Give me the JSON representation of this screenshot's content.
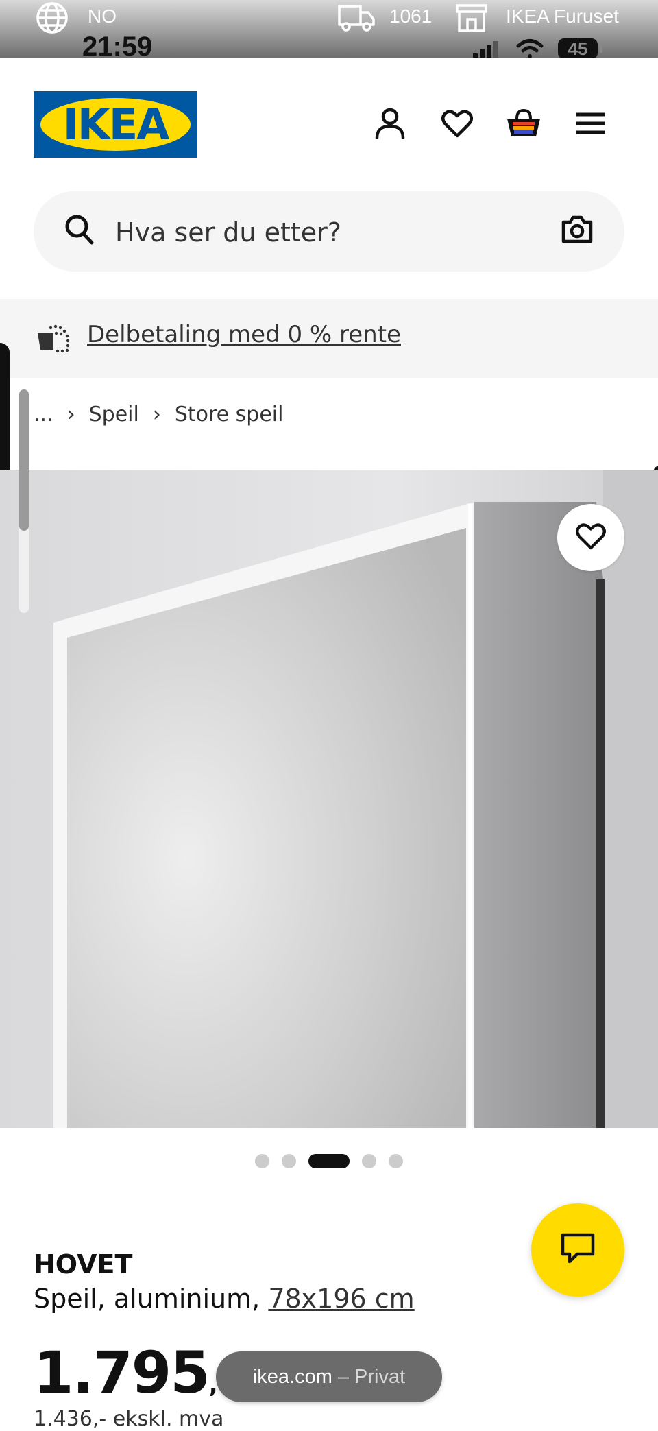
{
  "status_bar": {
    "language": "NO",
    "delivery_postcode": "1061",
    "store": "IKEA Furuset",
    "time": "21:59",
    "battery": "45"
  },
  "header": {
    "logo_text": "IKEA",
    "logo_reg": "®",
    "icons": [
      "profile-icon",
      "heart-icon",
      "basket-icon",
      "menu-icon"
    ]
  },
  "search": {
    "placeholder": "Hva ser du etter?"
  },
  "promo": {
    "text": "Delbetaling med 0 % rente"
  },
  "breadcrumb": {
    "ellipsis": "...",
    "items": [
      "Speil",
      "Store speil"
    ]
  },
  "gallery": {
    "total_images": 5,
    "active_index": 2
  },
  "product": {
    "name": "HOVET",
    "description": "Speil, aluminium,",
    "size": "78x196 cm",
    "price": "1.795",
    "price_suffix": ",-",
    "price_ex_vat": "1.436,- ekskl. mva"
  },
  "browser": {
    "domain": "ikea.com",
    "mode": "– Privat"
  },
  "colors": {
    "ikea_blue": "#0058a3",
    "ikea_yellow": "#ffdb00",
    "promo_bg": "#f5f5f5"
  }
}
